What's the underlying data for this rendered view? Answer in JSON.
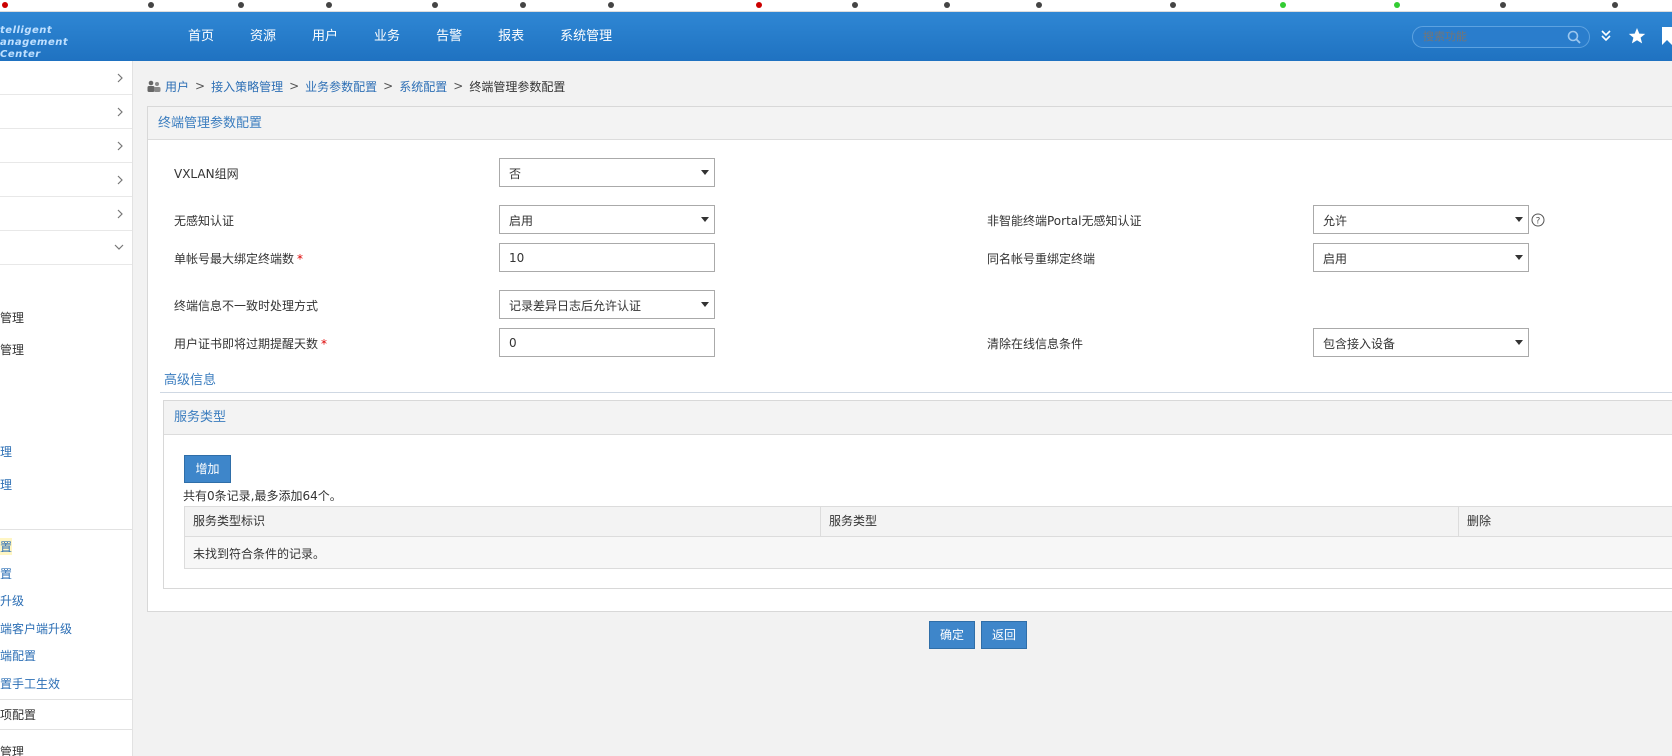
{
  "colors": {
    "header": "#1f72c1",
    "accent": "#3e86ca",
    "link": "#2d6fb5",
    "required": "#dd0000"
  },
  "header": {
    "logo_line1": "telligent",
    "logo_line2": "anagement Center",
    "nav": [
      "首页",
      "资源",
      "用户",
      "业务",
      "告警",
      "报表",
      "系统管理"
    ],
    "search_placeholder": "搜索功能",
    "icons": [
      "search-icon",
      "chevron-double-down-icon",
      "star-icon",
      "bookmark-icon"
    ]
  },
  "sidebar": {
    "items": [
      "管理",
      "管理",
      "理",
      "理",
      "置",
      "置",
      "升级",
      "端客户端升级",
      "端配置",
      "置手工生效",
      "项配置",
      "管理"
    ]
  },
  "breadcrumb": {
    "items": [
      "用户",
      "接入策略管理",
      "业务参数配置",
      "系统配置"
    ],
    "separator": ">",
    "current": "终端管理参数配置"
  },
  "panel": {
    "title": "终端管理参数配置"
  },
  "form": {
    "vxlan_label": "VXLAN组网",
    "vxlan_value": "否",
    "noauth_label": "无感知认证",
    "noauth_value": "启用",
    "nonsmart_label": "非智能终端Portal无感知认证",
    "nonsmart_value": "允许",
    "maxbind_label": "单帐号最大绑定终端数",
    "maxbind_value": "10",
    "samename_label": "同名帐号重绑定终端",
    "samename_value": "启用",
    "mismatch_label": "终端信息不一致时处理方式",
    "mismatch_value": "记录差异日志后允许认证",
    "certexpire_label": "用户证书即将过期提醒天数",
    "certexpire_value": "0",
    "clearonline_label": "清除在线信息条件",
    "clearonline_value": "包含接入设备",
    "required_mark": "*"
  },
  "advanced": {
    "title": "高级信息"
  },
  "service": {
    "title": "服务类型",
    "add_button": "增加",
    "count_text": "共有0条记录,最多添加64个。",
    "columns": [
      "服务类型标识",
      "服务类型",
      "删除"
    ],
    "empty_text": "未找到符合条件的记录。"
  },
  "actions": {
    "ok": "确定",
    "back": "返回"
  }
}
